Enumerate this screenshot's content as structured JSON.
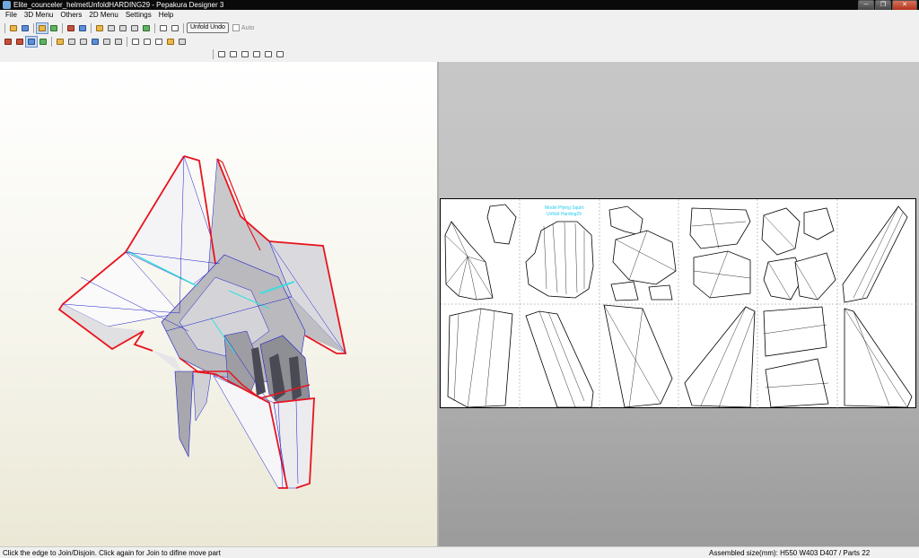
{
  "window": {
    "title": "Elite_counceler_helmetUnfoldHARDING29 - Pepakura Designer 3",
    "minimize": "─",
    "restore": "❐",
    "close": "✕"
  },
  "menu": [
    {
      "label": "File"
    },
    {
      "label": "3D Menu"
    },
    {
      "label": "Others"
    },
    {
      "label": "2D Menu"
    },
    {
      "label": "Settings"
    },
    {
      "label": "Help"
    }
  ],
  "toolbar": {
    "unfold_undo_label": "Unfold Undo",
    "auto_label": "Auto"
  },
  "sheet": {
    "annotation_line1": "Model Pfying Squirt",
    "annotation_line2": "Unfold Harding29"
  },
  "status": {
    "left": "Click the edge to Join/Disjoin. Click again for Join to difine move part",
    "right": "Assembled size(mm): H550 W403 D407 / Parts 22"
  },
  "colors": {
    "cut_edge": "#e8141e",
    "fold_line": "#1a1acc",
    "highlight": "#33e0e0",
    "titlebar": "#0a0a0a"
  }
}
